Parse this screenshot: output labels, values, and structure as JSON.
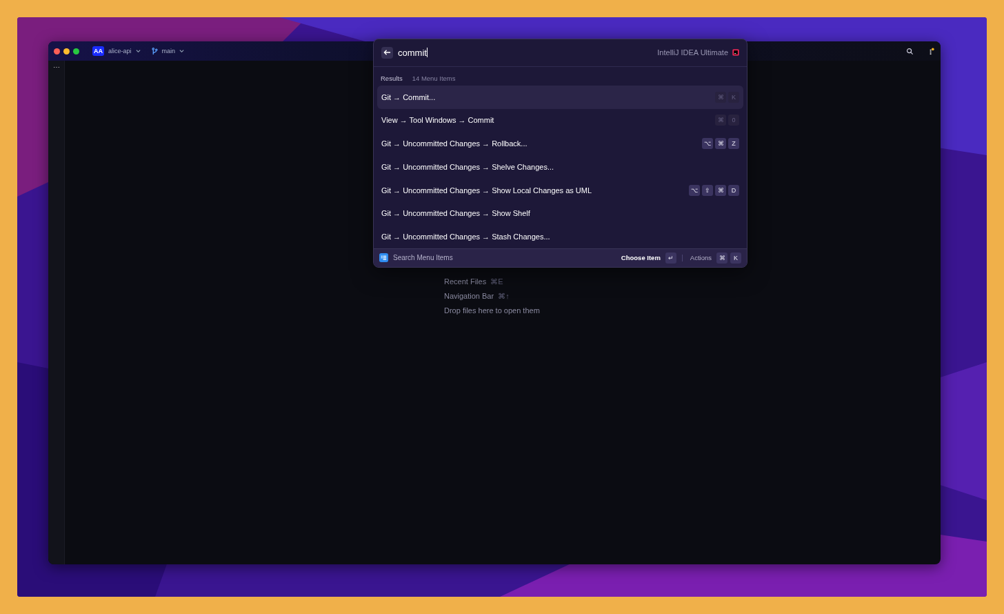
{
  "titlebar": {
    "project_badge": "AA",
    "project": "alice-api",
    "branch": "main",
    "gutter_menu": "⋯"
  },
  "hints": [
    {
      "label": "Recent Files",
      "shortcut": "⌘E"
    },
    {
      "label": "Navigation Bar",
      "shortcut": "⌘↑"
    },
    {
      "label": "Drop files here to open them"
    }
  ],
  "popup": {
    "query": "commit",
    "product": "IntelliJ IDEA Ultimate",
    "results_label": "Results",
    "results_count": "14 Menu Items",
    "items": [
      {
        "label": "Git → Commit...",
        "keys": [
          "⌘",
          "K"
        ],
        "keys_dimmed": true,
        "selected": true
      },
      {
        "label": "View → Tool Windows → Commit",
        "keys": [
          "⌘",
          "0"
        ],
        "keys_dimmed": true,
        "selected": false
      },
      {
        "label": "Git → Uncommitted Changes → Rollback...",
        "keys": [
          "⌥",
          "⌘",
          "Z"
        ],
        "keys_dimmed": false,
        "selected": false
      },
      {
        "label": "Git → Uncommitted Changes → Shelve Changes...",
        "selected": false
      },
      {
        "label": "Git → Uncommitted Changes → Show Local Changes as UML",
        "keys": [
          "⌥",
          "⇧",
          "⌘",
          "D"
        ],
        "keys_dimmed": false,
        "selected": false
      },
      {
        "label": "Git → Uncommitted Changes → Show Shelf",
        "selected": false
      },
      {
        "label": "Git → Uncommitted Changes → Stash Changes...",
        "selected": false
      }
    ],
    "footer": {
      "mode": "Search Menu Items",
      "choose": "Choose Item",
      "choose_key": "↵",
      "actions": "Actions",
      "actions_keys": [
        "⌘",
        "K"
      ]
    }
  }
}
